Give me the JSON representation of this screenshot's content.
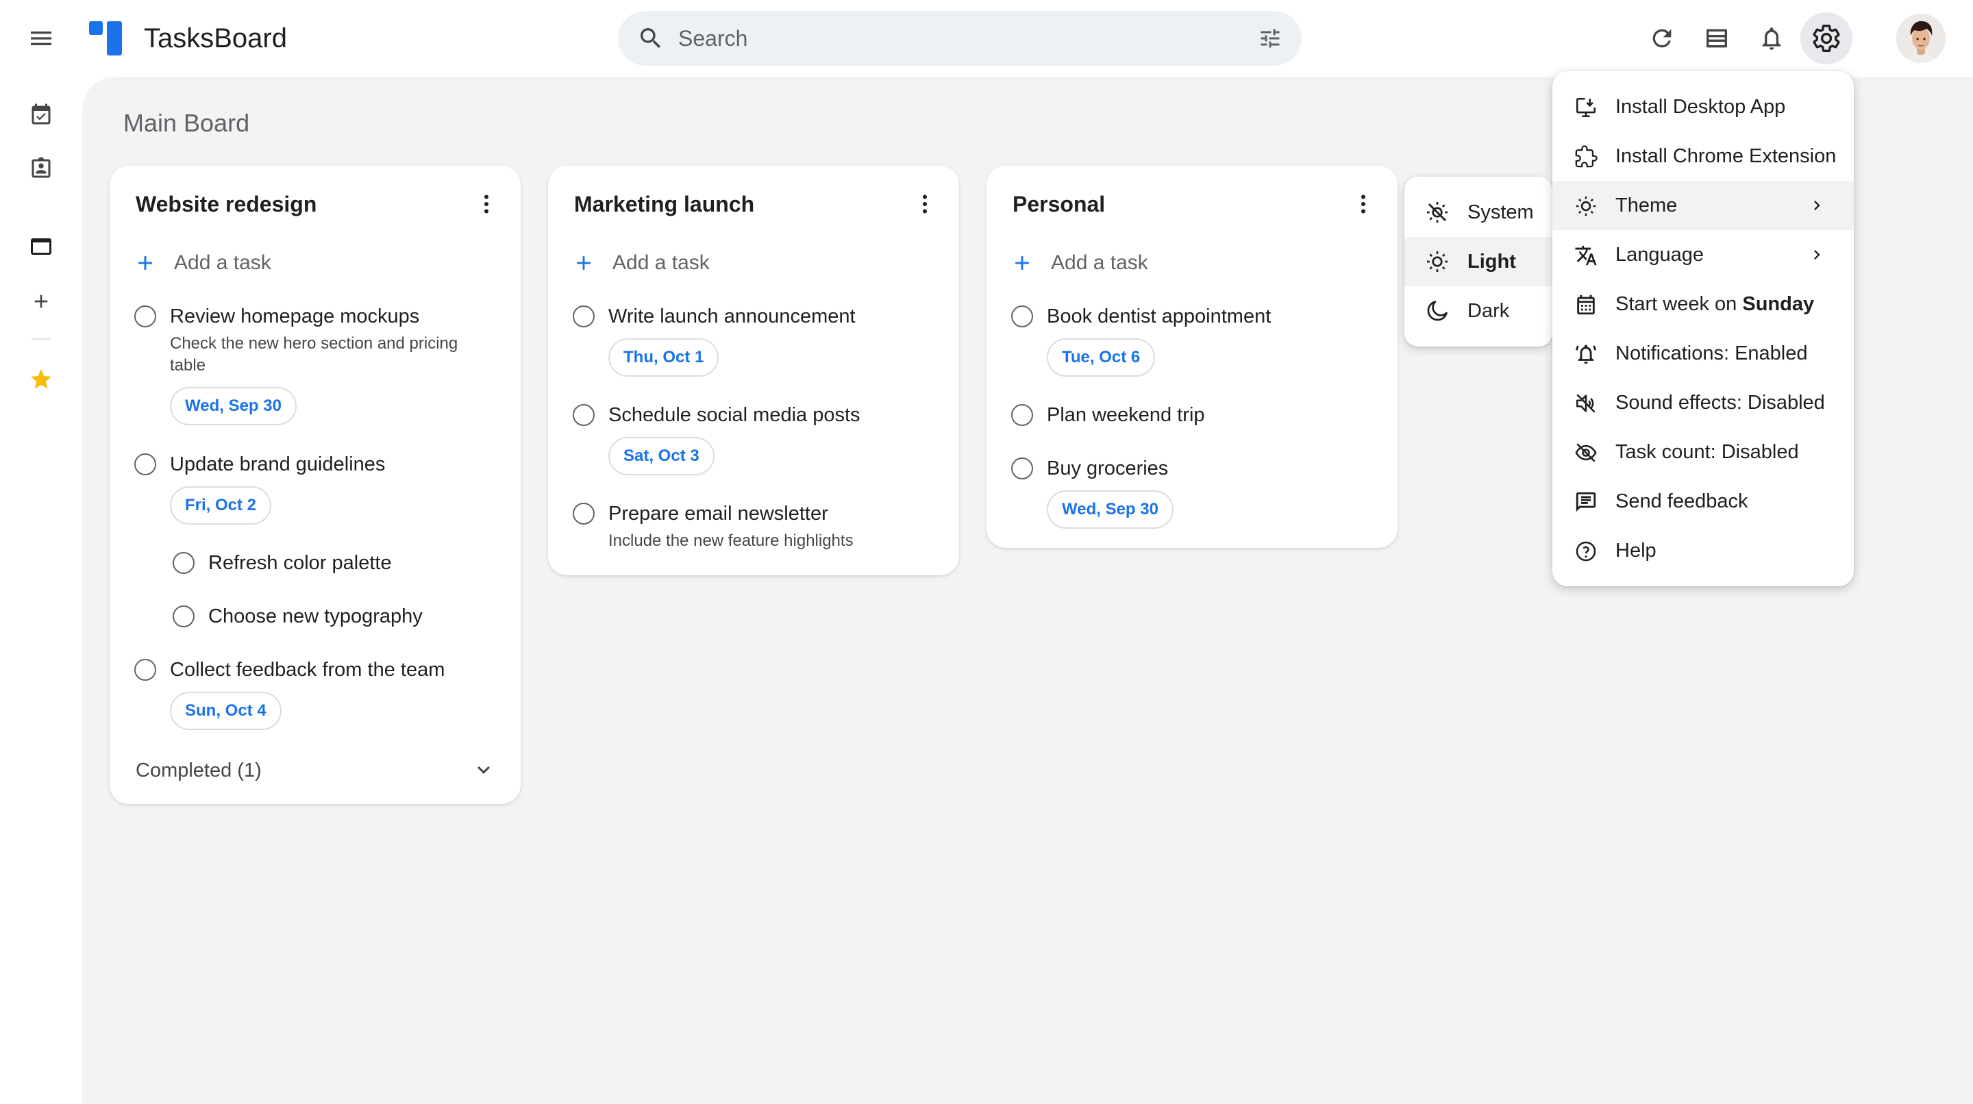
{
  "app": {
    "title": "TasksBoard"
  },
  "search": {
    "placeholder": "Search"
  },
  "board": {
    "title": "Main Board"
  },
  "columns": [
    {
      "title": "Website redesign",
      "add_label": "Add a task",
      "tasks": [
        {
          "title": "Review homepage mockups",
          "description": "Check the new hero section and pricing table",
          "date": "Wed, Sep 30"
        },
        {
          "title": "Update brand guidelines",
          "date": "Fri, Oct 2",
          "subtasks": [
            {
              "title": "Refresh color palette"
            },
            {
              "title": "Choose new typography"
            }
          ]
        },
        {
          "title": "Collect feedback from the team",
          "date": "Sun, Oct 4"
        }
      ],
      "completed_label": "Completed (1)"
    },
    {
      "title": "Marketing launch",
      "add_label": "Add a task",
      "tasks": [
        {
          "title": "Write launch announcement",
          "date": "Thu, Oct 1"
        },
        {
          "title": "Schedule social media posts",
          "date": "Sat, Oct 3"
        },
        {
          "title": "Prepare email newsletter",
          "description": "Include the new feature highlights"
        }
      ]
    },
    {
      "title": "Personal",
      "add_label": "Add a task",
      "tasks": [
        {
          "title": "Book dentist appointment",
          "date": "Tue, Oct 6"
        },
        {
          "title": "Plan weekend trip"
        },
        {
          "title": "Buy groceries",
          "date": "Wed, Sep 30"
        }
      ]
    }
  ],
  "theme_menu": {
    "items": [
      {
        "label": "System"
      },
      {
        "label": "Light"
      },
      {
        "label": "Dark"
      }
    ],
    "selected": "Light"
  },
  "settings_menu": {
    "items": [
      {
        "label": "Install Desktop App",
        "icon": "install-desktop-icon"
      },
      {
        "label": "Install Chrome Extension",
        "icon": "extension-icon"
      },
      {
        "label": "Theme",
        "icon": "theme-icon",
        "has_submenu": true
      },
      {
        "label": "Language",
        "icon": "translate-icon",
        "has_submenu": true
      },
      {
        "label": "Start week on ",
        "bold": "Sunday",
        "icon": "calendar-icon"
      },
      {
        "label": "Notifications: Enabled",
        "icon": "notification-icon"
      },
      {
        "label": "Sound effects: Disabled",
        "icon": "volume-off-icon"
      },
      {
        "label": "Task count: Disabled",
        "icon": "visibility-off-icon"
      },
      {
        "label": "Send feedback",
        "icon": "feedback-icon"
      },
      {
        "label": "Help",
        "icon": "help-icon"
      }
    ]
  },
  "colors": {
    "accent": "#1a73e8",
    "star": "#fbbc04",
    "canvas": "#f3f3f3",
    "search_bg": "#eef1f4"
  }
}
